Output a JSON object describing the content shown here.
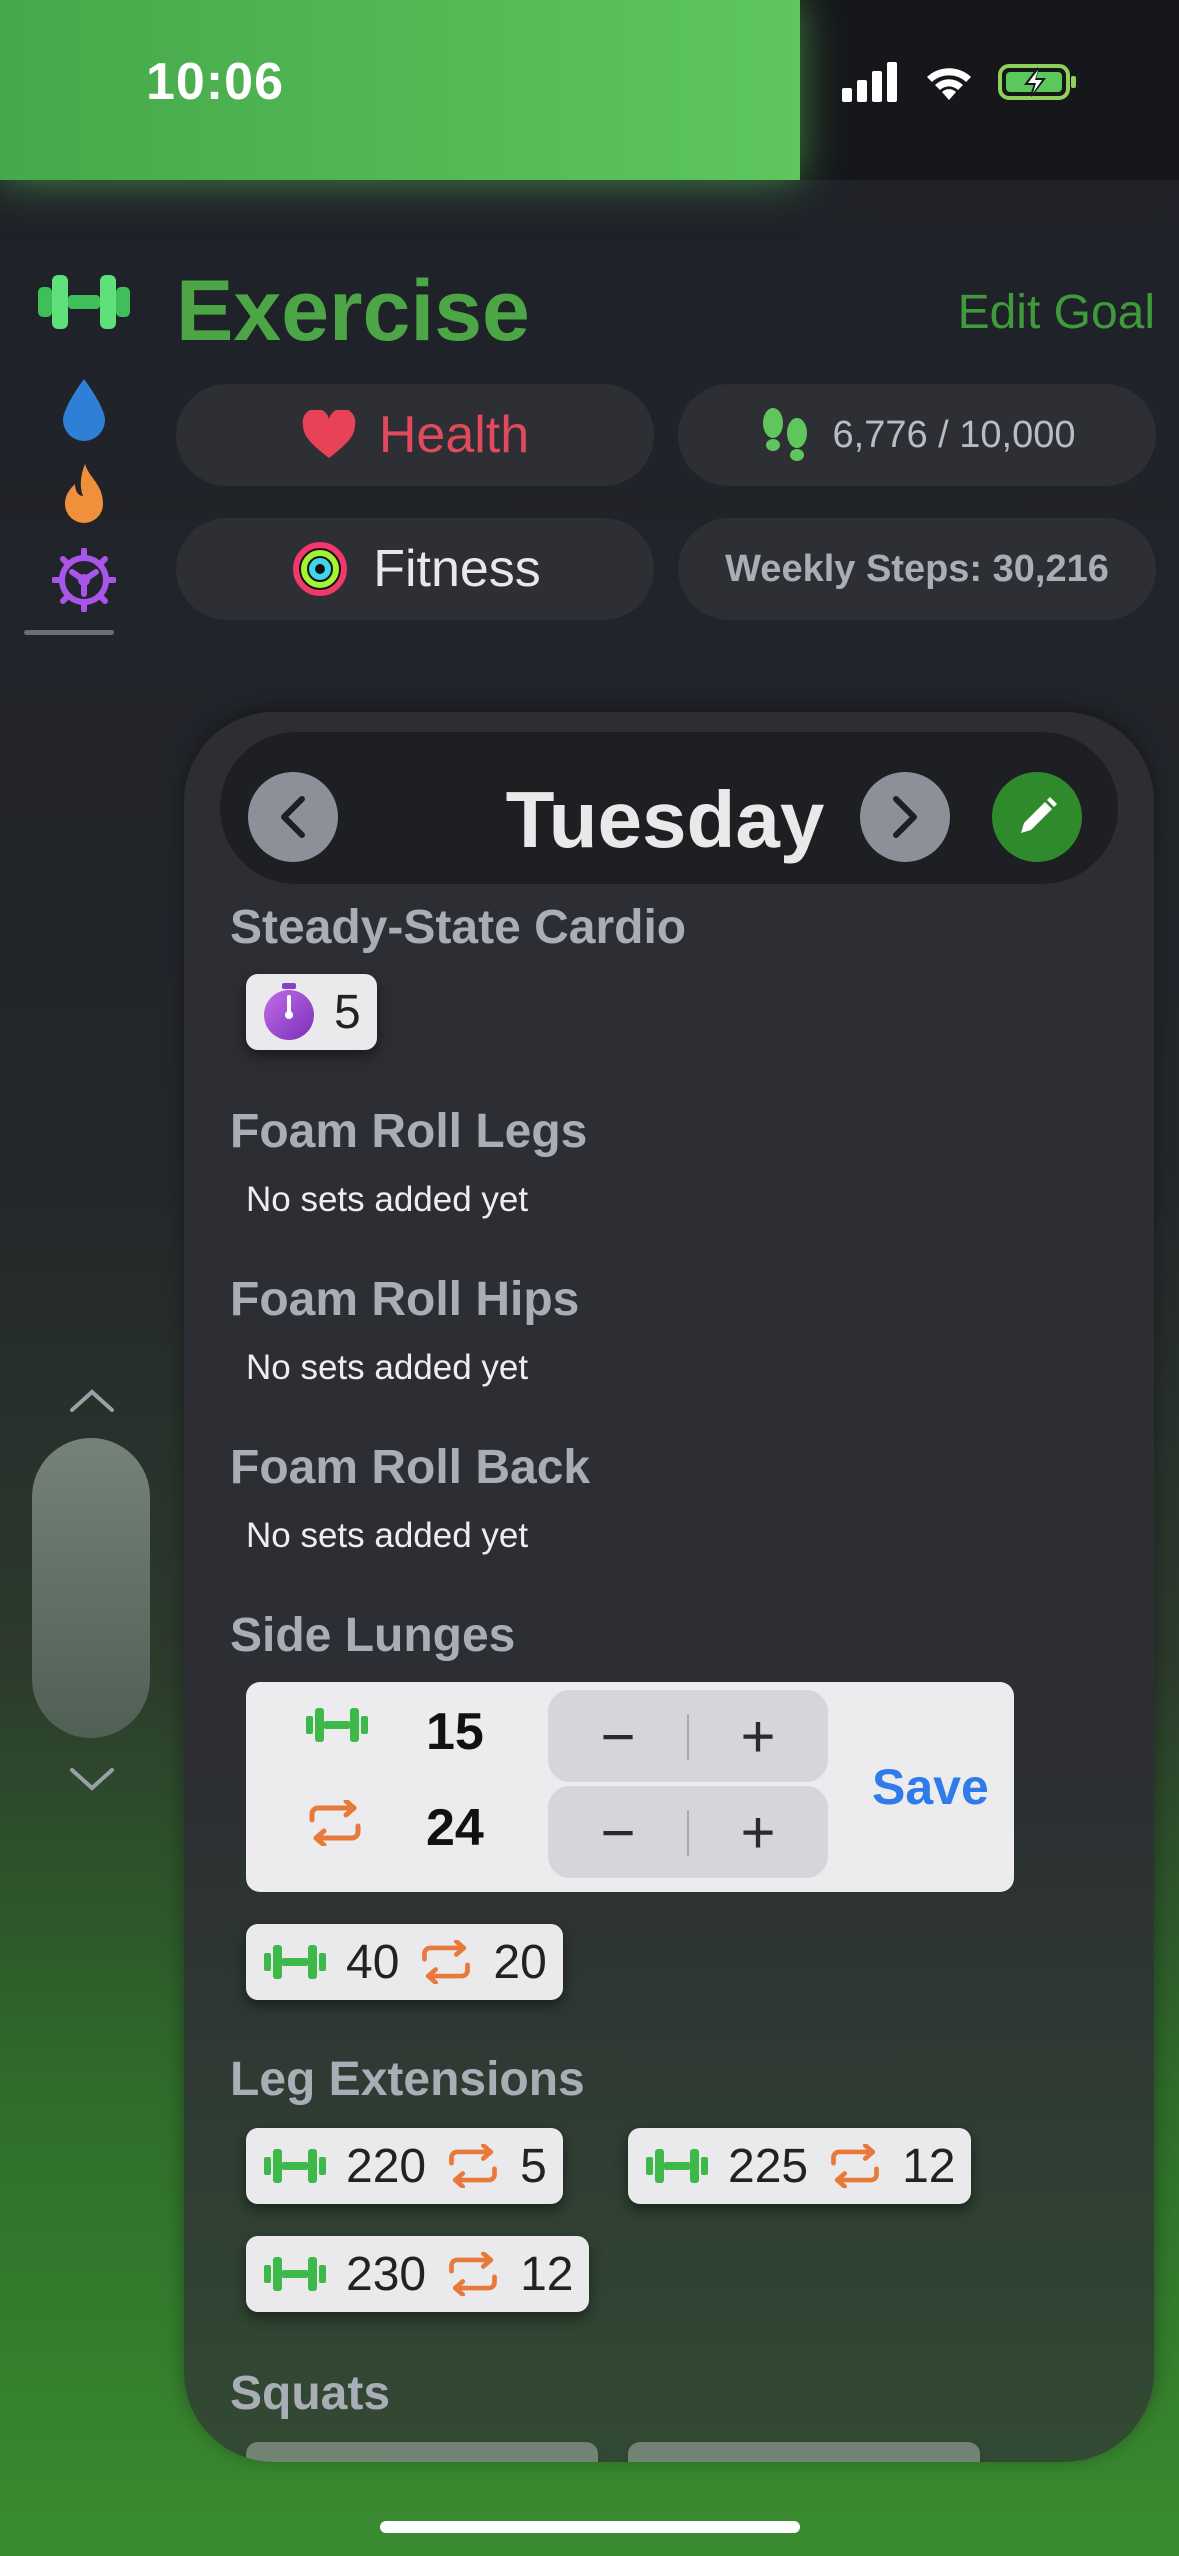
{
  "status_bar": {
    "time": "10:06"
  },
  "sidebar": {
    "icons": [
      "dumbbell-icon",
      "water-drop-icon",
      "flame-icon",
      "gear-icon"
    ]
  },
  "header": {
    "title": "Exercise",
    "edit_goal": "Edit Goal",
    "health_label": "Health",
    "steps_progress": "6,776 / 10,000",
    "fitness_label": "Fitness",
    "weekly_steps": "Weekly Steps: 30,216"
  },
  "day_nav": {
    "day": "Tuesday"
  },
  "exercises": [
    {
      "name": "Steady-State Cardio",
      "timer_value": "5"
    },
    {
      "name": "Foam Roll Legs",
      "empty": "No sets added yet"
    },
    {
      "name": "Foam Roll Hips",
      "empty": "No sets added yet"
    },
    {
      "name": "Foam Roll Back",
      "empty": "No sets added yet"
    },
    {
      "name": "Side Lunges",
      "editor": {
        "weight": "15",
        "reps": "24",
        "minus": "−",
        "plus": "+",
        "save": "Save"
      },
      "sets": [
        {
          "weight": "40",
          "reps": "20"
        }
      ]
    },
    {
      "name": "Leg Extensions",
      "sets": [
        {
          "weight": "220",
          "reps": "5"
        },
        {
          "weight": "225",
          "reps": "12"
        },
        {
          "weight": "230",
          "reps": "12"
        }
      ]
    },
    {
      "name": "Squats"
    }
  ],
  "colors": {
    "accent_green": "#4ca646",
    "health_red": "#e04a5c",
    "save_blue": "#2f7bea",
    "reps_orange": "#e8793a"
  }
}
